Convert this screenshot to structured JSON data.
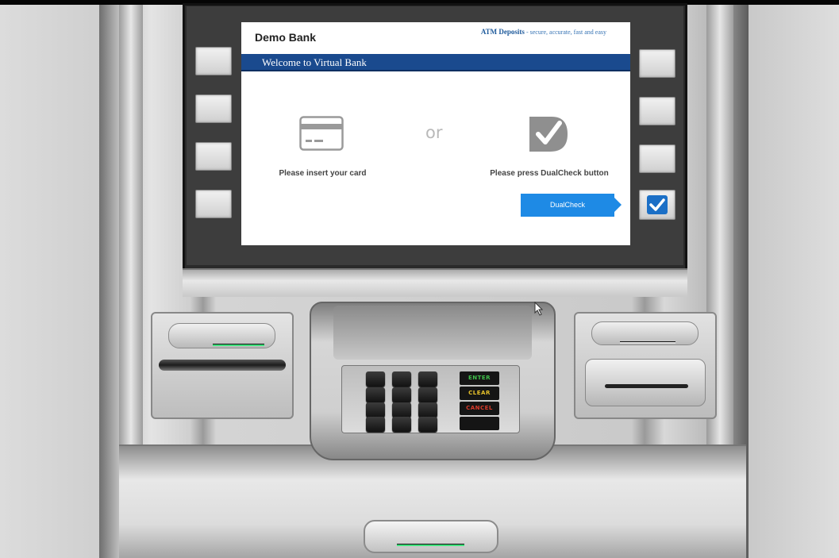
{
  "screen": {
    "bank_name": "Demo Bank",
    "tagline_main": "ATM Deposits",
    "tagline_rest": " - secure, accurate, fast and easy",
    "welcome": "Welcome to Virtual Bank",
    "card_prompt": "Please insert your card",
    "or_label": "or",
    "dualcheck_prompt": "Please press DualCheck button",
    "dualcheck_button": "DualCheck"
  },
  "keypad": {
    "function_keys": [
      {
        "label": "ENTER",
        "color": "#3fbf4a"
      },
      {
        "label": "CLEAR",
        "color": "#e8c22a"
      },
      {
        "label": "CANCEL",
        "color": "#d93a2a"
      }
    ]
  },
  "colors": {
    "accent": "#1e8ae5",
    "welcome_bar": "#1a4a8e",
    "indicator_led": "#3ee17b"
  },
  "icons": {
    "card": "card-icon",
    "dualcheck": "check-badge-icon",
    "checkbox": "checkbox-checked-icon"
  }
}
